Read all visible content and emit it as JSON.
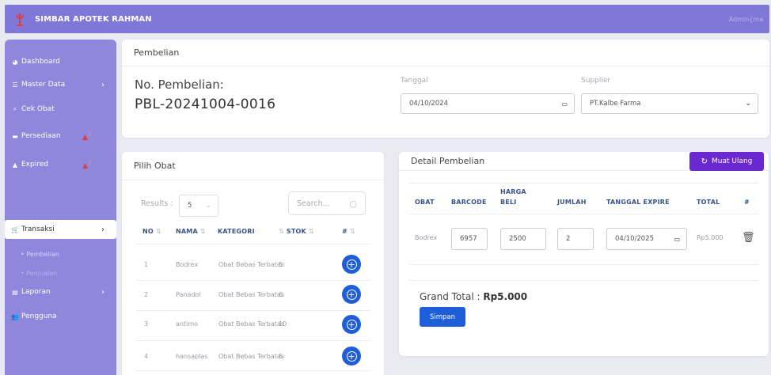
{
  "topbar": {
    "brand": "SIMBAR APOTEK RAHMAN",
    "user": "Admin{ma"
  },
  "sidebar": {
    "dashboard": "Dashboard",
    "master_data": "Master Data",
    "cek_obat": "Cek Obat",
    "persediaan": "Persediaan",
    "persediaan_count": "1",
    "expired": "Expired",
    "expired_count": "1",
    "transaksi": "Transaksi",
    "pembelian": "Pembelian",
    "penjualan": "Penjualan",
    "laporan": "Laporan",
    "pengguna": "Pengguna"
  },
  "pembelian": {
    "title": "Pembelian",
    "no_label": "No. Pembelian:",
    "no_value": "PBL-20241004-0016",
    "tanggal_label": "Tanggal",
    "tanggal_value": "04/10/2024",
    "supplier_label": "Supplier",
    "supplier_value": "PT.Kalbe Farma"
  },
  "pilih_obat": {
    "title": "Pilih Obat",
    "results_label": "Results :",
    "results_value": "5",
    "search_placeholder": "Search...",
    "headers": {
      "no": "NO",
      "nama": "NAMA",
      "kategori": "KATEGORI",
      "stok": "STOK",
      "hash": "#"
    },
    "rows": [
      {
        "no": "1",
        "nama": "Bodrex",
        "kategori": "Obat Bebas Terbatas",
        "stok": "5"
      },
      {
        "no": "2",
        "nama": "Panadol",
        "kategori": "Obat Bebas Terbatas",
        "stok": "6"
      },
      {
        "no": "3",
        "nama": "antimo",
        "kategori": "Obat Bebas Terbatas",
        "stok": "10"
      },
      {
        "no": "4",
        "nama": "hansaplas",
        "kategori": "Obat Bebas Terbatas",
        "stok": "5"
      }
    ]
  },
  "detail": {
    "title": "Detail Pembelian",
    "reload": "Muat Ulang",
    "headers": {
      "obat": "OBAT",
      "barcode": "BARCODE",
      "harga1": "HARGA",
      "harga2": "BELI",
      "jumlah": "JUMLAH",
      "expire": "TANGGAL EXPIRE",
      "total": "TOTAL",
      "hash": "#"
    },
    "row": {
      "obat": "Bodrex",
      "barcode": "6957",
      "harga": "2500",
      "jumlah": "2",
      "expire": "04/10/2025",
      "total": "Rp5.000"
    },
    "grand_label": "Grand Total :",
    "grand_value": "Rp5.000",
    "save": "Simpan"
  },
  "colors": {
    "topbar": "#7f78d8",
    "sidebar": "#8e87db",
    "primary": "#1e5fd9",
    "purple": "#6a28d1",
    "alert": "#e03c3c"
  }
}
